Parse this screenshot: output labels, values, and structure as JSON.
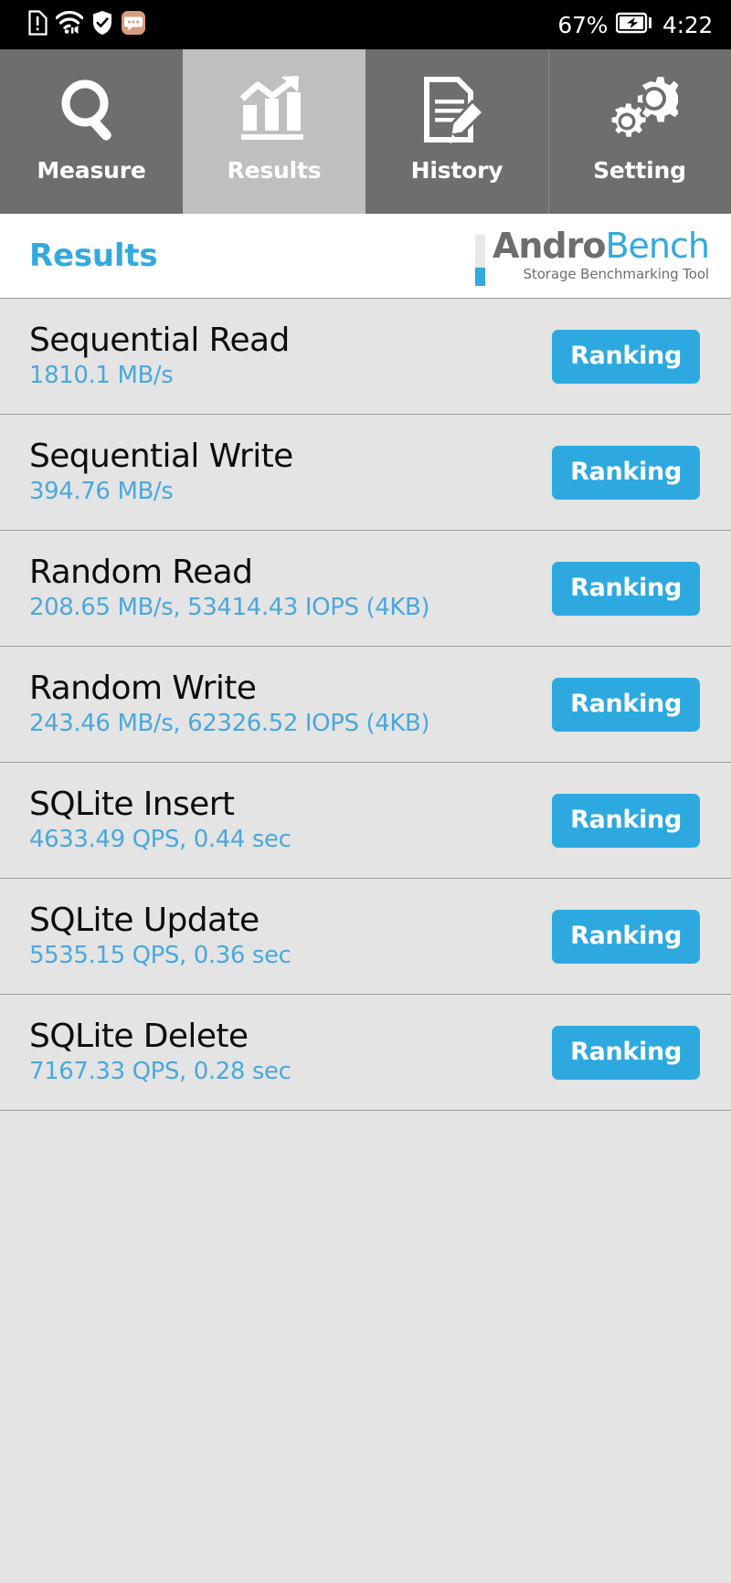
{
  "status_bar": {
    "icons_left": [
      "sim-alert-icon",
      "wifi-icon",
      "shield-check-icon",
      "message-bubble-icon"
    ],
    "battery_percent": "67%",
    "battery_icon": "battery-charging-icon",
    "time": "4:22"
  },
  "tabs": [
    {
      "label": "Measure",
      "icon": "magnifier-icon",
      "active": false
    },
    {
      "label": "Results",
      "icon": "bar-chart-trend-icon",
      "active": true
    },
    {
      "label": "History",
      "icon": "document-pencil-icon",
      "active": false
    },
    {
      "label": "Setting",
      "icon": "gears-icon",
      "active": false
    }
  ],
  "header": {
    "title": "Results",
    "logo_primary": "Andro",
    "logo_secondary": "Bench",
    "logo_subtitle": "Storage Benchmarking Tool"
  },
  "colors": {
    "accent_blue": "#34a9dd",
    "button_blue": "#2ea9e0",
    "value_blue": "#4aa8dc",
    "list_bg": "#e4e4e4",
    "tab_inactive": "#6e6e6e",
    "tab_active": "#bfbfbf",
    "statusbar_bg": "#000000"
  },
  "results": [
    {
      "name": "Sequential Read",
      "value": "1810.1 MB/s",
      "action": "Ranking"
    },
    {
      "name": "Sequential Write",
      "value": "394.76 MB/s",
      "action": "Ranking"
    },
    {
      "name": "Random Read",
      "value": "208.65 MB/s, 53414.43 IOPS (4KB)",
      "action": "Ranking"
    },
    {
      "name": "Random Write",
      "value": "243.46 MB/s, 62326.52 IOPS (4KB)",
      "action": "Ranking"
    },
    {
      "name": "SQLite Insert",
      "value": "4633.49 QPS, 0.44 sec",
      "action": "Ranking"
    },
    {
      "name": "SQLite Update",
      "value": "5535.15 QPS, 0.36 sec",
      "action": "Ranking"
    },
    {
      "name": "SQLite Delete",
      "value": "7167.33 QPS, 0.28 sec",
      "action": "Ranking"
    }
  ]
}
